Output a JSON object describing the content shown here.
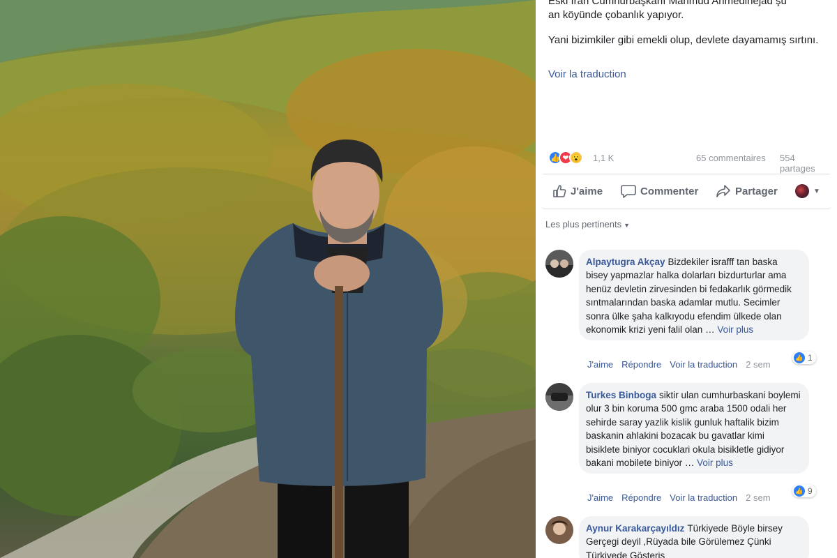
{
  "post": {
    "text_clip": "Eski İran Cumhurbaşkanı Mahmud Ahmedinejad şu",
    "text_line2": "an köyünde çobanlık yapıyor.",
    "text_para2": "Yani bizimkiler gibi emekli olup, devlete dayamamış sırtını.",
    "translate_label": "Voir la traduction"
  },
  "stats": {
    "reaction_count": "1,1 K",
    "comments": "65 commentaires",
    "shares": "554 partages"
  },
  "actions": {
    "like": "J'aime",
    "comment": "Commenter",
    "share": "Partager"
  },
  "sort_label": "Les plus pertinents",
  "comments": [
    {
      "author": "Alpaytugra Akçay",
      "text": "Bizdekiler israfff tan baska bisey yapmazlar halka dolarları bizdurturlar ama henüz devletin zirvesinden bi fedakarlık görmedik sıntmalarından baska adamlar mutlu. Secimler sonra ülke şaha kalkıyodu efendim ülkede olan ekonomik krizi yeni falil olan …",
      "see_more": "Voir plus",
      "like": "J'aime",
      "reply": "Répondre",
      "translate": "Voir la traduction",
      "time": "2 sem",
      "reactions": "1"
    },
    {
      "author": "Turkes Binboga",
      "text": "siktir ulan cumhurbaskani boylemi olur 3 bin koruma 500 gmc araba 1500 odali her sehirde saray yazlik kislik gunluk haftalik bizim baskanin ahlakini bozacak bu gavatlar kimi bisiklete biniyor cocuklari okula bisikletle gidiyor bakani mobilete biniyor …",
      "see_more": "Voir plus",
      "like": "J'aime",
      "reply": "Répondre",
      "translate": "Voir la traduction",
      "time": "2 sem",
      "reactions": "9"
    },
    {
      "author": "Aynur Karakarçayıldız",
      "text": "Türkiyede Böyle birsey Gerçegi deyil ,Rüyada bile Görülemez Çünki Türkiyede Gösteris"
    }
  ],
  "icons": {
    "like": "thumbs-up-icon",
    "comment": "speech-bubble-icon",
    "share": "share-arrow-icon",
    "reactions": [
      "like-reaction-icon",
      "love-reaction-icon",
      "wow-reaction-icon"
    ]
  },
  "colors": {
    "link": "#385898",
    "muted": "#90949c",
    "bubble": "#f2f3f5",
    "like_blue": "#2e7ff5"
  }
}
